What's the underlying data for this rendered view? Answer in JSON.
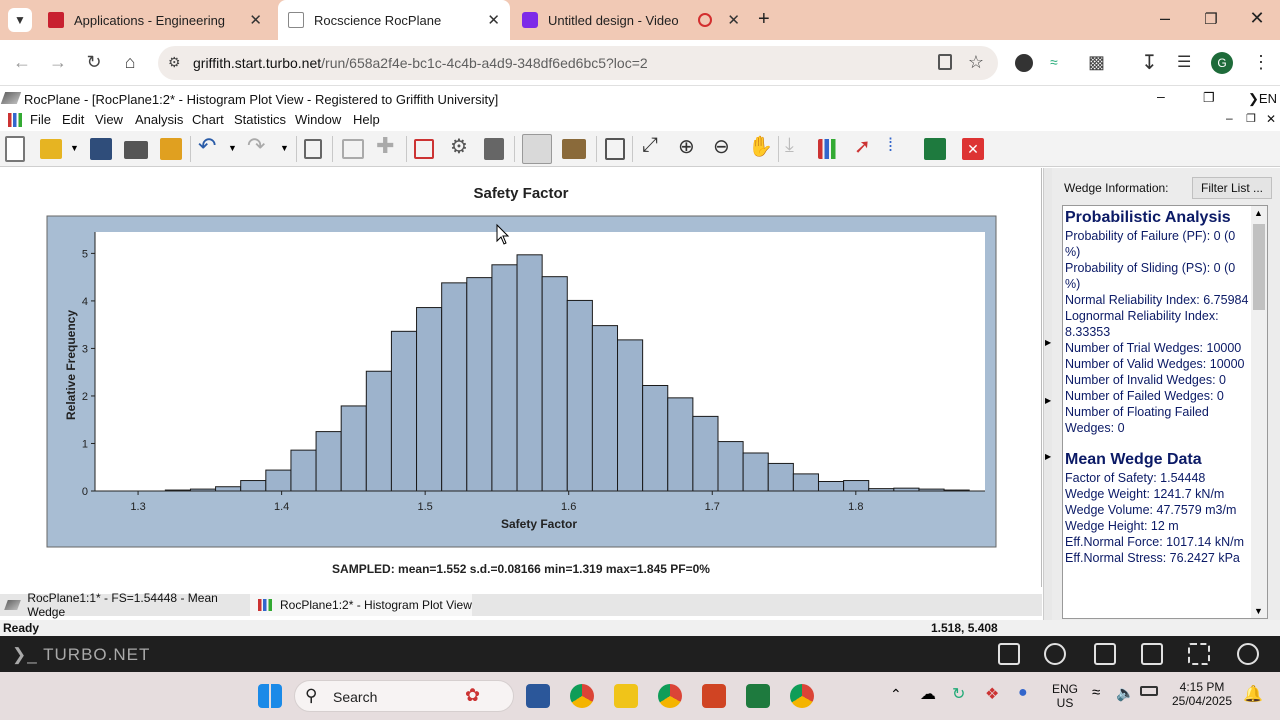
{
  "browser": {
    "tabs": [
      {
        "label": "Applications - Engineering"
      },
      {
        "label": "Rocscience RocPlane"
      },
      {
        "label": "Untitled design - Video"
      }
    ],
    "url_host": "griffith.start.turbo.net",
    "url_path": "/run/658a2f4e-bc1c-4c4b-a4d9-348df6ed6bc5?loc=2",
    "profile_initial": "G"
  },
  "app": {
    "title": "RocPlane - [RocPlane1:2* - Histogram Plot View - Registered to Griffith University]",
    "lang": "EN",
    "menu": [
      "File",
      "Edit",
      "View",
      "Analysis",
      "Chart",
      "Statistics",
      "Window",
      "Help"
    ]
  },
  "chart_data": {
    "type": "bar",
    "title": "Safety Factor",
    "xlabel": "Safety Factor",
    "ylabel": "Relative Frequency",
    "xlim": [
      1.27,
      1.89
    ],
    "ylim": [
      0,
      5.45
    ],
    "xticks": [
      1.3,
      1.4,
      1.5,
      1.6,
      1.7,
      1.8
    ],
    "yticks": [
      0,
      1,
      2,
      3,
      4,
      5
    ],
    "bin_width": 0.0175,
    "bin_start": 1.319,
    "values": [
      0.02,
      0.04,
      0.09,
      0.22,
      0.44,
      0.86,
      1.25,
      1.79,
      2.52,
      3.36,
      3.86,
      4.38,
      4.49,
      4.76,
      4.97,
      4.51,
      4.01,
      3.48,
      3.18,
      2.22,
      1.96,
      1.57,
      1.04,
      0.8,
      0.58,
      0.36,
      0.2,
      0.22,
      0.05,
      0.06,
      0.04,
      0.02
    ],
    "summary": "SAMPLED: mean=1.552 s.d.=0.08166 min=1.319 max=1.845 PF=0%",
    "plot_bg": "#a8bdd3",
    "bar_color": "#9db3cc"
  },
  "panel": {
    "label": "Wedge Information:",
    "filter_button": "Filter List ...",
    "prob_title": "Probabilistic Analysis",
    "prob_lines": [
      "Probability of Failure (PF): 0 (0 %)",
      "Probability of Sliding (PS): 0 (0 %)",
      "Normal Reliability Index: 6.75984",
      "Lognormal Reliability Index: 8.33353",
      "Number of Trial Wedges: 10000",
      "Number of Valid Wedges: 10000",
      "Number of Invalid Wedges: 0",
      "Number of Failed Wedges: 0",
      "Number of Floating Failed Wedges: 0"
    ],
    "mean_title": "Mean Wedge Data",
    "mean_lines": [
      "Factor of Safety: 1.54448",
      "Wedge Weight: 1241.7 kN/m",
      "Wedge Volume: 47.7579 m3/m",
      "Wedge Height: 12 m",
      "Eff.Normal Force: 1017.14 kN/m",
      "Eff.Normal Stress: 76.2427 kPa"
    ]
  },
  "doc_tabs": [
    {
      "label": "RocPlane1:1* - FS=1.54448 - Mean Wedge"
    },
    {
      "label": "RocPlane1:2* - Histogram Plot View"
    }
  ],
  "status": {
    "left": "Ready",
    "right": "1.518, 5.408"
  },
  "turbo": {
    "logo": "TURBO.NET"
  },
  "taskbar": {
    "search_label": "Search",
    "lang_top": "ENG",
    "lang_bottom": "US",
    "time": "4:15 PM",
    "date": "25/04/2025"
  }
}
